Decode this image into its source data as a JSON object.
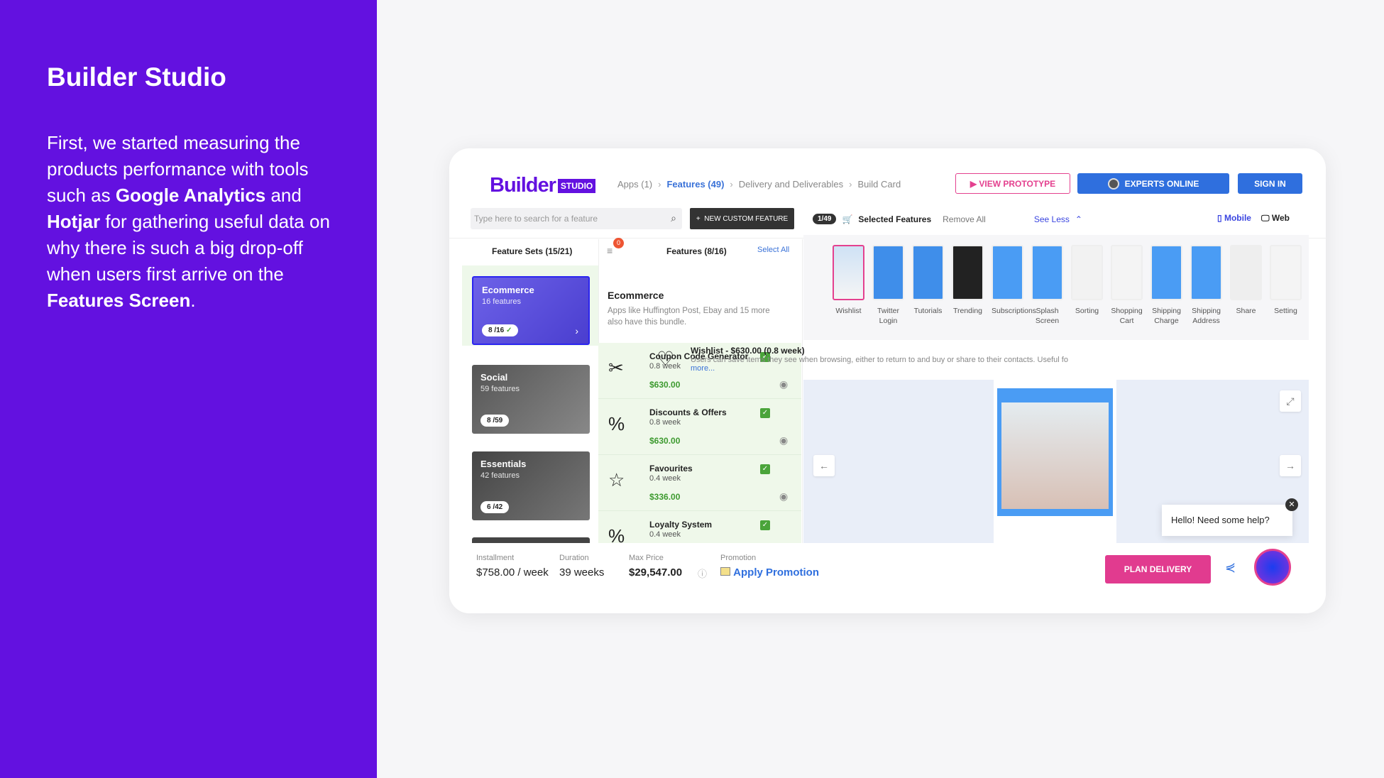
{
  "slide": {
    "title": "Builder Studio",
    "paragraph_lines": [
      [
        {
          "t": "First, we started measuring the",
          "b": false
        }
      ],
      [
        {
          "t": "products performance with tools",
          "b": false
        }
      ],
      [
        {
          "t": "such as ",
          "b": false
        },
        {
          "t": "Google Analytics",
          "b": true
        },
        {
          "t": " and",
          "b": false
        }
      ],
      [
        {
          "t": "Hotjar",
          "b": true
        },
        {
          "t": " for gathering useful data on",
          "b": false
        }
      ],
      [
        {
          "t": "why there is such a big drop-off",
          "b": false
        }
      ],
      [
        {
          "t": "when users first arrive on the",
          "b": false
        }
      ],
      [
        {
          "t": "Features Screen",
          "b": true
        },
        {
          "t": ".",
          "b": false
        }
      ]
    ]
  },
  "header": {
    "logo_main": "Builder",
    "logo_badge": "STUDIO",
    "breadcrumbs": [
      "Apps (1)",
      "Features (49)",
      "Delivery and Deliverables",
      "Build Card"
    ],
    "view_prototype": "VIEW PROTOTYPE",
    "experts_online": "EXPERTS ONLINE",
    "sign_in": "SIGN IN"
  },
  "search": {
    "placeholder": "Type here to search for a feature",
    "new_custom_feature": "NEW CUSTOM FEATURE"
  },
  "feature_sets": {
    "header": "Feature Sets (15/21)",
    "filter_badge": "0",
    "items": [
      {
        "title": "Ecommerce",
        "count": "16 features",
        "badge": "8 /16"
      },
      {
        "title": "Social",
        "count": "59 features",
        "badge": "8 /59"
      },
      {
        "title": "Essentials",
        "count": "42 features",
        "badge": "6 /42"
      }
    ]
  },
  "features": {
    "header": "Features (8/16)",
    "select_all": "Select All",
    "bundle_title": "Ecommerce",
    "bundle_desc": "Apps like Huffington Post, Ebay and 15 more also have this bundle.",
    "items": [
      {
        "name": "Coupon Code Generator",
        "duration": "0.8 week",
        "price": "$630.00",
        "icon": "coupon-icon"
      },
      {
        "name": "Discounts & Offers",
        "duration": "0.8 week",
        "price": "$630.00",
        "icon": "percent-badge-icon"
      },
      {
        "name": "Favourites",
        "duration": "0.4 week",
        "price": "$336.00",
        "icon": "star-icon"
      },
      {
        "name": "Loyalty System",
        "duration": "0.4 week",
        "price": "",
        "icon": "percent-badge-icon"
      }
    ]
  },
  "selected": {
    "count": "1/49",
    "title": "Selected Features",
    "remove_all": "Remove All",
    "see_less": "See Less",
    "mobile": "Mobile",
    "web": "Web",
    "thumbs": [
      "Wishlist",
      "Twitter Login",
      "Tutorials",
      "Trending",
      "Subscriptions",
      "Splash Screen",
      "Sorting",
      "Shopping Cart",
      "Shipping Charge",
      "Shipping Address",
      "Share",
      "Setting"
    ],
    "detail_title": "Wishlist - $630.00 (0.8 week)",
    "detail_desc": "Users can save items they see when browsing, either to return to and buy or share to their contacts. Useful fo",
    "more": "more..."
  },
  "chat": {
    "text": "Hello! Need some help?"
  },
  "footer": {
    "installment_label": "Installment",
    "installment": "$758.00 / week",
    "duration_label": "Duration",
    "duration": "39 weeks",
    "max_price_label": "Max Price",
    "max_price": "$29,547.00",
    "promotion_label": "Promotion",
    "apply_promotion": "Apply Promotion",
    "plan_delivery": "PLAN DELIVERY"
  },
  "colors": {
    "brand_purple": "#6311e0",
    "accent_pink": "#e13b8f",
    "primary_blue": "#2f6fde",
    "success_green": "#3d9a2f"
  }
}
